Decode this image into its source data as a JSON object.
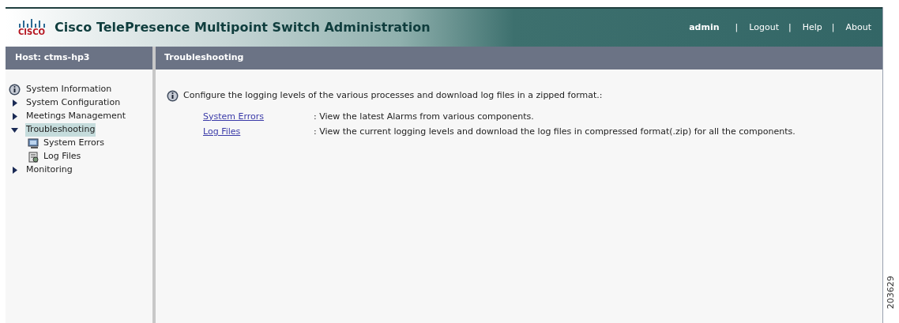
{
  "header": {
    "logo_text": "CISCO",
    "title": "Cisco TelePresence Multipoint Switch Administration",
    "user": "admin",
    "links": [
      {
        "separator": "|",
        "label": "Logout"
      },
      {
        "separator": "|",
        "label": "Help"
      },
      {
        "separator": "|",
        "label": "About"
      }
    ]
  },
  "sidebar": {
    "host": "Host: ctms-hp3",
    "items": [
      {
        "label": "System Information",
        "kind": "info",
        "selected": false
      },
      {
        "label": "System Configuration",
        "kind": "folder",
        "expanded": false,
        "selected": false
      },
      {
        "label": "Meetings Management",
        "kind": "folder",
        "expanded": false,
        "selected": false
      },
      {
        "label": "Troubleshooting",
        "kind": "folder",
        "expanded": true,
        "selected": true,
        "children": [
          {
            "label": "System Errors",
            "kind": "monitor",
            "selected": false
          },
          {
            "label": "Log Files",
            "kind": "log",
            "selected": false
          }
        ]
      },
      {
        "label": "Monitoring",
        "kind": "folder",
        "expanded": false,
        "selected": false
      }
    ]
  },
  "content": {
    "title": "Troubleshooting",
    "intro": "Configure the logging levels of the various processes and download log files in a zipped format.:",
    "links": [
      {
        "label": "System Errors",
        "description": ": View the latest Alarms from various components."
      },
      {
        "label": "Log Files",
        "description": ": View the current logging levels and download the log files in compressed format(.zip) for all the components."
      }
    ]
  },
  "figure_number": "203629"
}
